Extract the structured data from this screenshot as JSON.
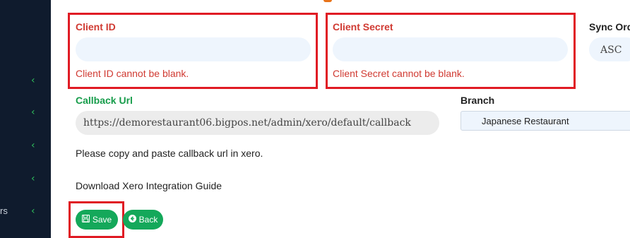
{
  "sidebar": {
    "items": [
      "",
      "",
      "",
      "",
      "rs"
    ],
    "chevron_glyph": "‹"
  },
  "form": {
    "client_id": {
      "label": "Client ID",
      "value": "",
      "error": "Client ID cannot be blank."
    },
    "client_secret": {
      "label": "Client Secret",
      "value": "",
      "error": "Client Secret cannot be blank."
    },
    "sync_order": {
      "label": "Sync Ord",
      "value": "ASC"
    },
    "callback_url": {
      "label": "Callback Url",
      "value": "https://demorestaurant06.bigpos.net/admin/xero/default/callback",
      "help": "Please copy and paste callback url in xero."
    },
    "branch": {
      "label": "Branch",
      "value": "Japanese Restaurant"
    },
    "download_guide": "Download Xero Integration Guide"
  },
  "buttons": {
    "save_label": "Save",
    "save_icon": "floppy-disk-icon",
    "back_label": "Back",
    "back_icon": "circle-arrow-left-icon"
  },
  "colors": {
    "sidebar_bg": "#0f1b2d",
    "accent_green": "#14a85a",
    "error_red": "#d03a32",
    "highlight_red": "#e01b24"
  }
}
